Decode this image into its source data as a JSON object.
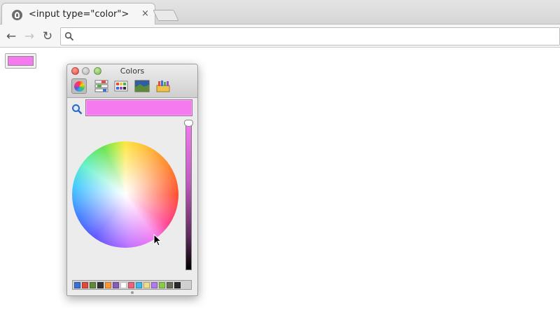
{
  "browser": {
    "tab_title": "<input type=\"color\">",
    "tab_close": "×",
    "back_glyph": "←",
    "forward_glyph": "→",
    "reload_glyph": "↻",
    "icons": [
      "back-arrow-icon",
      "forward-arrow-icon",
      "reload-icon",
      "search-icon"
    ]
  },
  "page": {
    "color_input_value": "#f57af0"
  },
  "colors_panel": {
    "title": "Colors",
    "modes": [
      "color-wheel",
      "color-sliders",
      "color-palettes",
      "image-palettes",
      "crayons"
    ],
    "selected_mode": "color-wheel",
    "current_color": "#f57af0",
    "brightness_level": 1.0,
    "favorite_swatches": [
      "#3a6fd6",
      "#e04a3c",
      "#5f8a3a",
      "#333333",
      "#ff9933",
      "#8a5ab8",
      "#ffffff",
      "#e8647a",
      "#3fb8e8",
      "#f0dc8a",
      "#b07ae8",
      "#8cc84a",
      "#6b6b5a",
      "#2a2a2a"
    ]
  }
}
